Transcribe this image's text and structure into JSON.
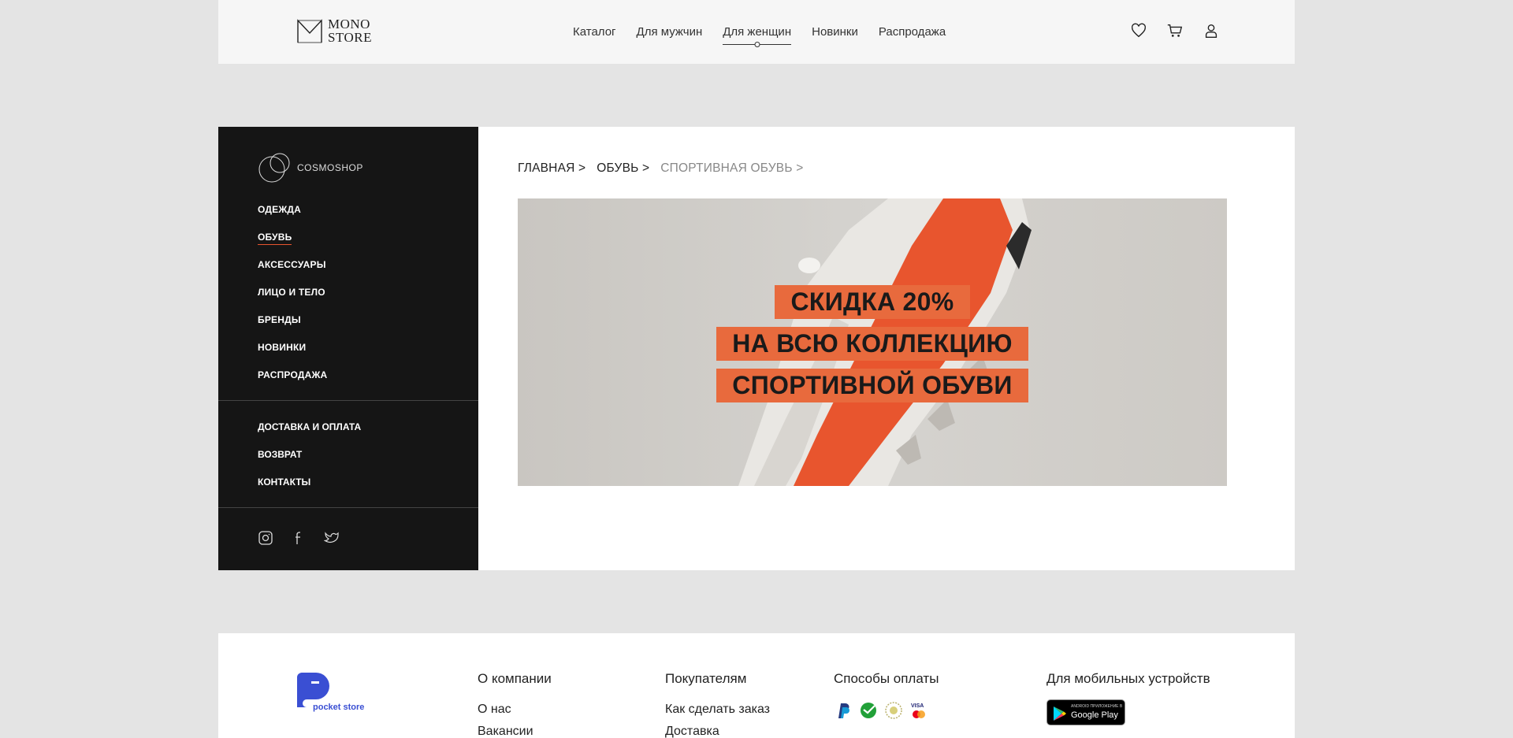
{
  "header": {
    "logo_line1": "MONO",
    "logo_line2": "STORE",
    "nav": [
      "Каталог",
      "Для мужчин",
      "Для женщин",
      "Новинки",
      "Распродажа"
    ],
    "active_nav": "Для женщин",
    "icons": [
      "heart-icon",
      "cart-icon",
      "user-icon"
    ]
  },
  "sidebar": {
    "brand": "COSMOSHOP",
    "menu": [
      "ОДЕЖДА",
      "ОБУВЬ",
      "АКСЕССУАРЫ",
      "ЛИЦО И ТЕЛО",
      "БРЕНДЫ",
      "НОВИНКИ",
      "РАСПРОДАЖА"
    ],
    "active_menu": "ОБУВЬ",
    "menu2": [
      "ДОСТАВКА И ОПЛАТА",
      "ВОЗВРАТ",
      "КОНТАКТЫ"
    ],
    "socials": [
      "instagram-icon",
      "facebook-icon",
      "twitter-icon"
    ],
    "accent_color": "#e8552e"
  },
  "breadcrumb": [
    "ГЛАВНАЯ >",
    "ОБУВЬ >",
    "СПОРТИВНАЯ ОБУВЬ >"
  ],
  "banner": {
    "lines": [
      "СКИДКА 20%",
      "НА ВСЮ КОЛЛЕКЦИЮ",
      "СПОРТИВНОЙ ОБУВИ"
    ],
    "highlight_color": "#e86a3d"
  },
  "footer": {
    "logo_text": "pocket store",
    "columns": [
      {
        "title": "О компании",
        "links": [
          "О нас",
          "Вакансии"
        ]
      },
      {
        "title": "Покупателям",
        "links": [
          "Как сделать заказ",
          "Доставка"
        ]
      },
      {
        "title": "Способы оплаты",
        "links": []
      },
      {
        "title": "Для мобильных устройств",
        "links": []
      }
    ],
    "payment_icons": [
      "paypal-icon",
      "sberbank-icon",
      "tinkoff-icon",
      "visa-mastercard-icon"
    ],
    "app_badge_small": "ANDROID ПРИЛОЖЕНИЕ В",
    "app_badge_big": "Google Play"
  }
}
